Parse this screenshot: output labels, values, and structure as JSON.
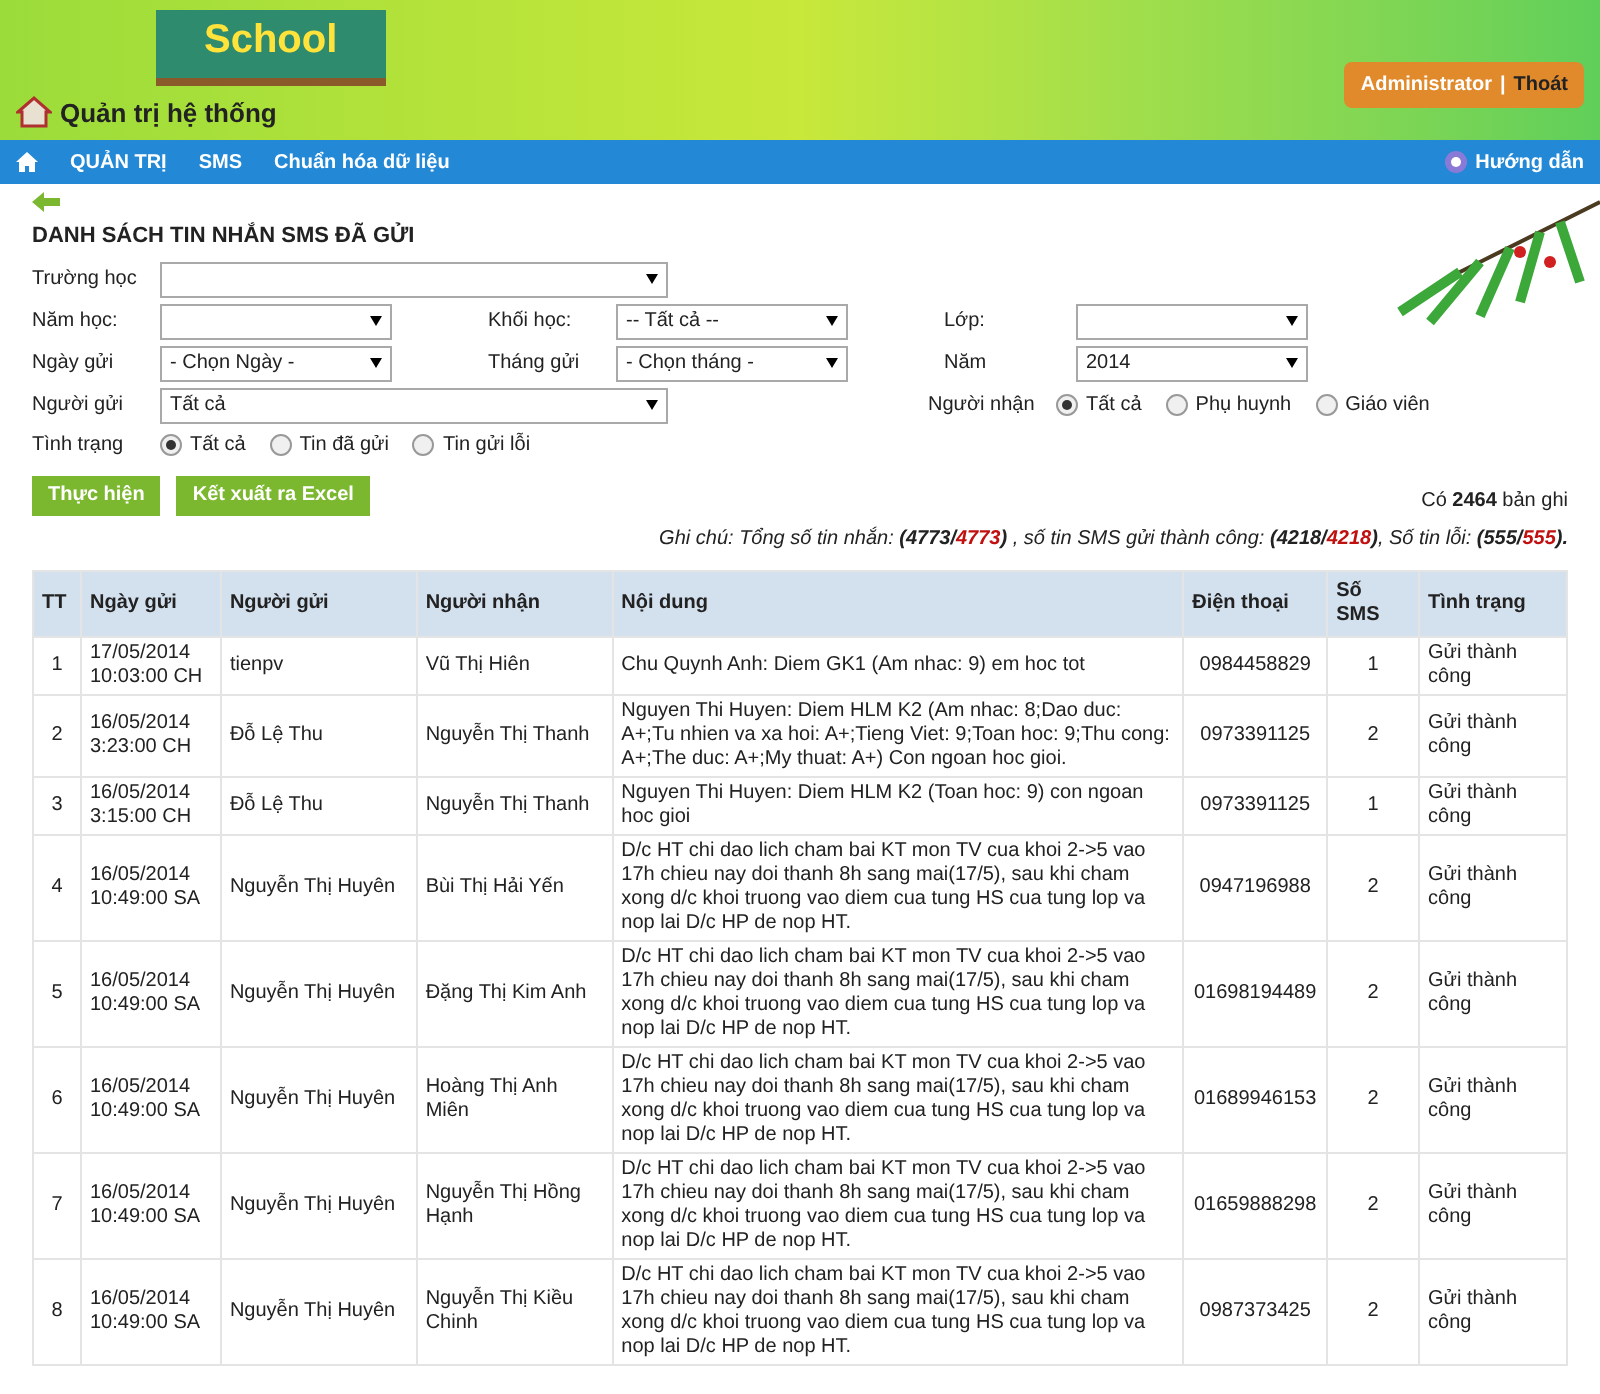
{
  "header": {
    "logo_text": "School",
    "title": "Quản trị hệ thống",
    "user": "Administrator",
    "separator": "|",
    "logout": "Thoát"
  },
  "nav": {
    "items": [
      {
        "label": "QUẢN TRỊ"
      },
      {
        "label": "SMS"
      },
      {
        "label": "Chuẩn hóa dữ liệu"
      }
    ],
    "help": "Hướng dẫn"
  },
  "page_title": "DANH SÁCH TIN NHẮN SMS ĐÃ GỬI",
  "filter_rows": [
    [
      {
        "kind": "select",
        "label": "Trường học"
      }
    ],
    [
      {
        "kind": "select",
        "label": "Năm học:"
      },
      {
        "kind": "select",
        "label": "Khối học:",
        "value": "-- Tất cả --"
      },
      {
        "kind": "select",
        "label": "Lớp:"
      }
    ],
    [
      {
        "kind": "select",
        "label": "Ngày gửi",
        "value": "- Chọn Ngày -"
      },
      {
        "kind": "select",
        "label": "Tháng gửi",
        "value": "- Chọn tháng -"
      },
      {
        "kind": "select",
        "label": "Năm",
        "value": "2014"
      }
    ],
    [
      {
        "kind": "select",
        "label": "Người gửi",
        "value": "Tất cả"
      },
      {
        "kind": "radio",
        "label": "Người nhận",
        "options": [
          {
            "label": "Tất cả",
            "selected": true
          },
          {
            "label": "Phụ huynh",
            "selected": false
          },
          {
            "label": "Giáo viên",
            "selected": false
          }
        ]
      }
    ],
    [
      {
        "kind": "radio",
        "label": "Tình trạng",
        "options": [
          {
            "label": "Tất cả",
            "selected": true
          },
          {
            "label": "Tin đã gửi",
            "selected": false
          },
          {
            "label": "Tin gửi lỗi",
            "selected": false
          }
        ]
      }
    ]
  ],
  "buttons": [
    "Thực hiện",
    "Kết xuất ra Excel"
  ],
  "record_count": "Có **2464** bản ghi",
  "summary": [
    {
      "kind": "plain",
      "text": "Ghi chú: Tổng số tin nhắn: "
    },
    {
      "kind": "bold",
      "text": "(4773/"
    },
    {
      "kind": "red",
      "text": "4773"
    },
    {
      "kind": "bold",
      "text": ")"
    },
    {
      "kind": "plain",
      "text": " , số tin SMS gửi thành công: "
    },
    {
      "kind": "bold",
      "text": "(4218/"
    },
    {
      "kind": "red",
      "text": "4218"
    },
    {
      "kind": "bold",
      "text": ")"
    },
    {
      "kind": "plain",
      "text": ", Số tin lỗi: "
    },
    {
      "kind": "bold",
      "text": "(555/"
    },
    {
      "kind": "red",
      "text": "555"
    },
    {
      "kind": "bold",
      "text": ")."
    }
  ],
  "table": {
    "columns": [
      "TT",
      "Ngày gửi",
      "Người gửi",
      "Người nhận",
      "Nội dung",
      "Điện thoại",
      "Số SMS",
      "Tình trạng"
    ],
    "rows": [
      [
        "1",
        "17/05/2014 10:03:00 CH",
        "tienpv",
        "Vũ Thị Hiên",
        "Chu Quynh Anh: Diem GK1 (Am nhac: 9) em hoc tot",
        "0984458829",
        "1",
        "Gửi thành công"
      ],
      [
        "2",
        "16/05/2014 3:23:00 CH",
        "Đỗ Lệ Thu",
        "Nguyễn Thị Thanh",
        "Nguyen Thi Huyen: Diem HLM K2 (Am nhac: 8;Dao duc: A+;Tu nhien va xa hoi: A+;Tieng Viet: 9;Toan hoc: 9;Thu cong: A+;The duc: A+;My thuat: A+) Con ngoan hoc gioi.",
        "0973391125",
        "2",
        "Gửi thành công"
      ],
      [
        "3",
        "16/05/2014 3:15:00 CH",
        "Đỗ Lệ Thu",
        "Nguyễn Thị Thanh",
        "Nguyen Thi Huyen: Diem HLM K2 (Toan hoc: 9) con ngoan hoc gioi",
        "0973391125",
        "1",
        "Gửi thành công"
      ],
      [
        "4",
        "16/05/2014 10:49:00 SA",
        "Nguyễn Thị Huyên",
        "Bùi Thị Hải Yến",
        "D/c HT chi dao lich cham bai KT mon TV cua khoi 2->5 vao 17h chieu nay doi thanh 8h sang mai(17/5), sau khi cham xong d/c khoi truong vao diem cua tung HS cua tung lop va nop lai D/c HP de nop HT.",
        "0947196988",
        "2",
        "Gửi thành công"
      ],
      [
        "5",
        "16/05/2014 10:49:00 SA",
        "Nguyễn Thị Huyên",
        "Đặng Thị Kim Anh",
        "D/c HT chi dao lich cham bai KT mon TV cua khoi 2->5 vao 17h chieu nay doi thanh 8h sang mai(17/5), sau khi cham xong d/c khoi truong vao diem cua tung HS cua tung lop va nop lai D/c HP de nop HT.",
        "01698194489",
        "2",
        "Gửi thành công"
      ],
      [
        "6",
        "16/05/2014 10:49:00 SA",
        "Nguyễn Thị Huyên",
        "Hoàng Thị Anh Miên",
        "D/c HT chi dao lich cham bai KT mon TV cua khoi 2->5 vao 17h chieu nay doi thanh 8h sang mai(17/5), sau khi cham xong d/c khoi truong vao diem cua tung HS cua tung lop va nop lai D/c HP de nop HT.",
        "01689946153",
        "2",
        "Gửi thành công"
      ],
      [
        "7",
        "16/05/2014 10:49:00 SA",
        "Nguyễn Thị Huyên",
        "Nguyễn Thị Hồng Hạnh",
        "D/c HT chi dao lich cham bai KT mon TV cua khoi 2->5 vao 17h chieu nay doi thanh 8h sang mai(17/5), sau khi cham xong d/c khoi truong vao diem cua tung HS cua tung lop va nop lai D/c HP de nop HT.",
        "01659888298",
        "2",
        "Gửi thành công"
      ],
      [
        "8",
        "16/05/2014 10:49:00 SA",
        "Nguyễn Thị Huyên",
        "Nguyễn Thị Kiều Chinh",
        "D/c HT chi dao lich cham bai KT mon TV cua khoi 2->5 vao 17h chieu nay doi thanh 8h sang mai(17/5), sau khi cham xong d/c khoi truong vao diem cua tung HS cua tung lop va nop lai D/c HP de nop HT.",
        "0987373425",
        "2",
        "Gửi thành công"
      ]
    ]
  }
}
